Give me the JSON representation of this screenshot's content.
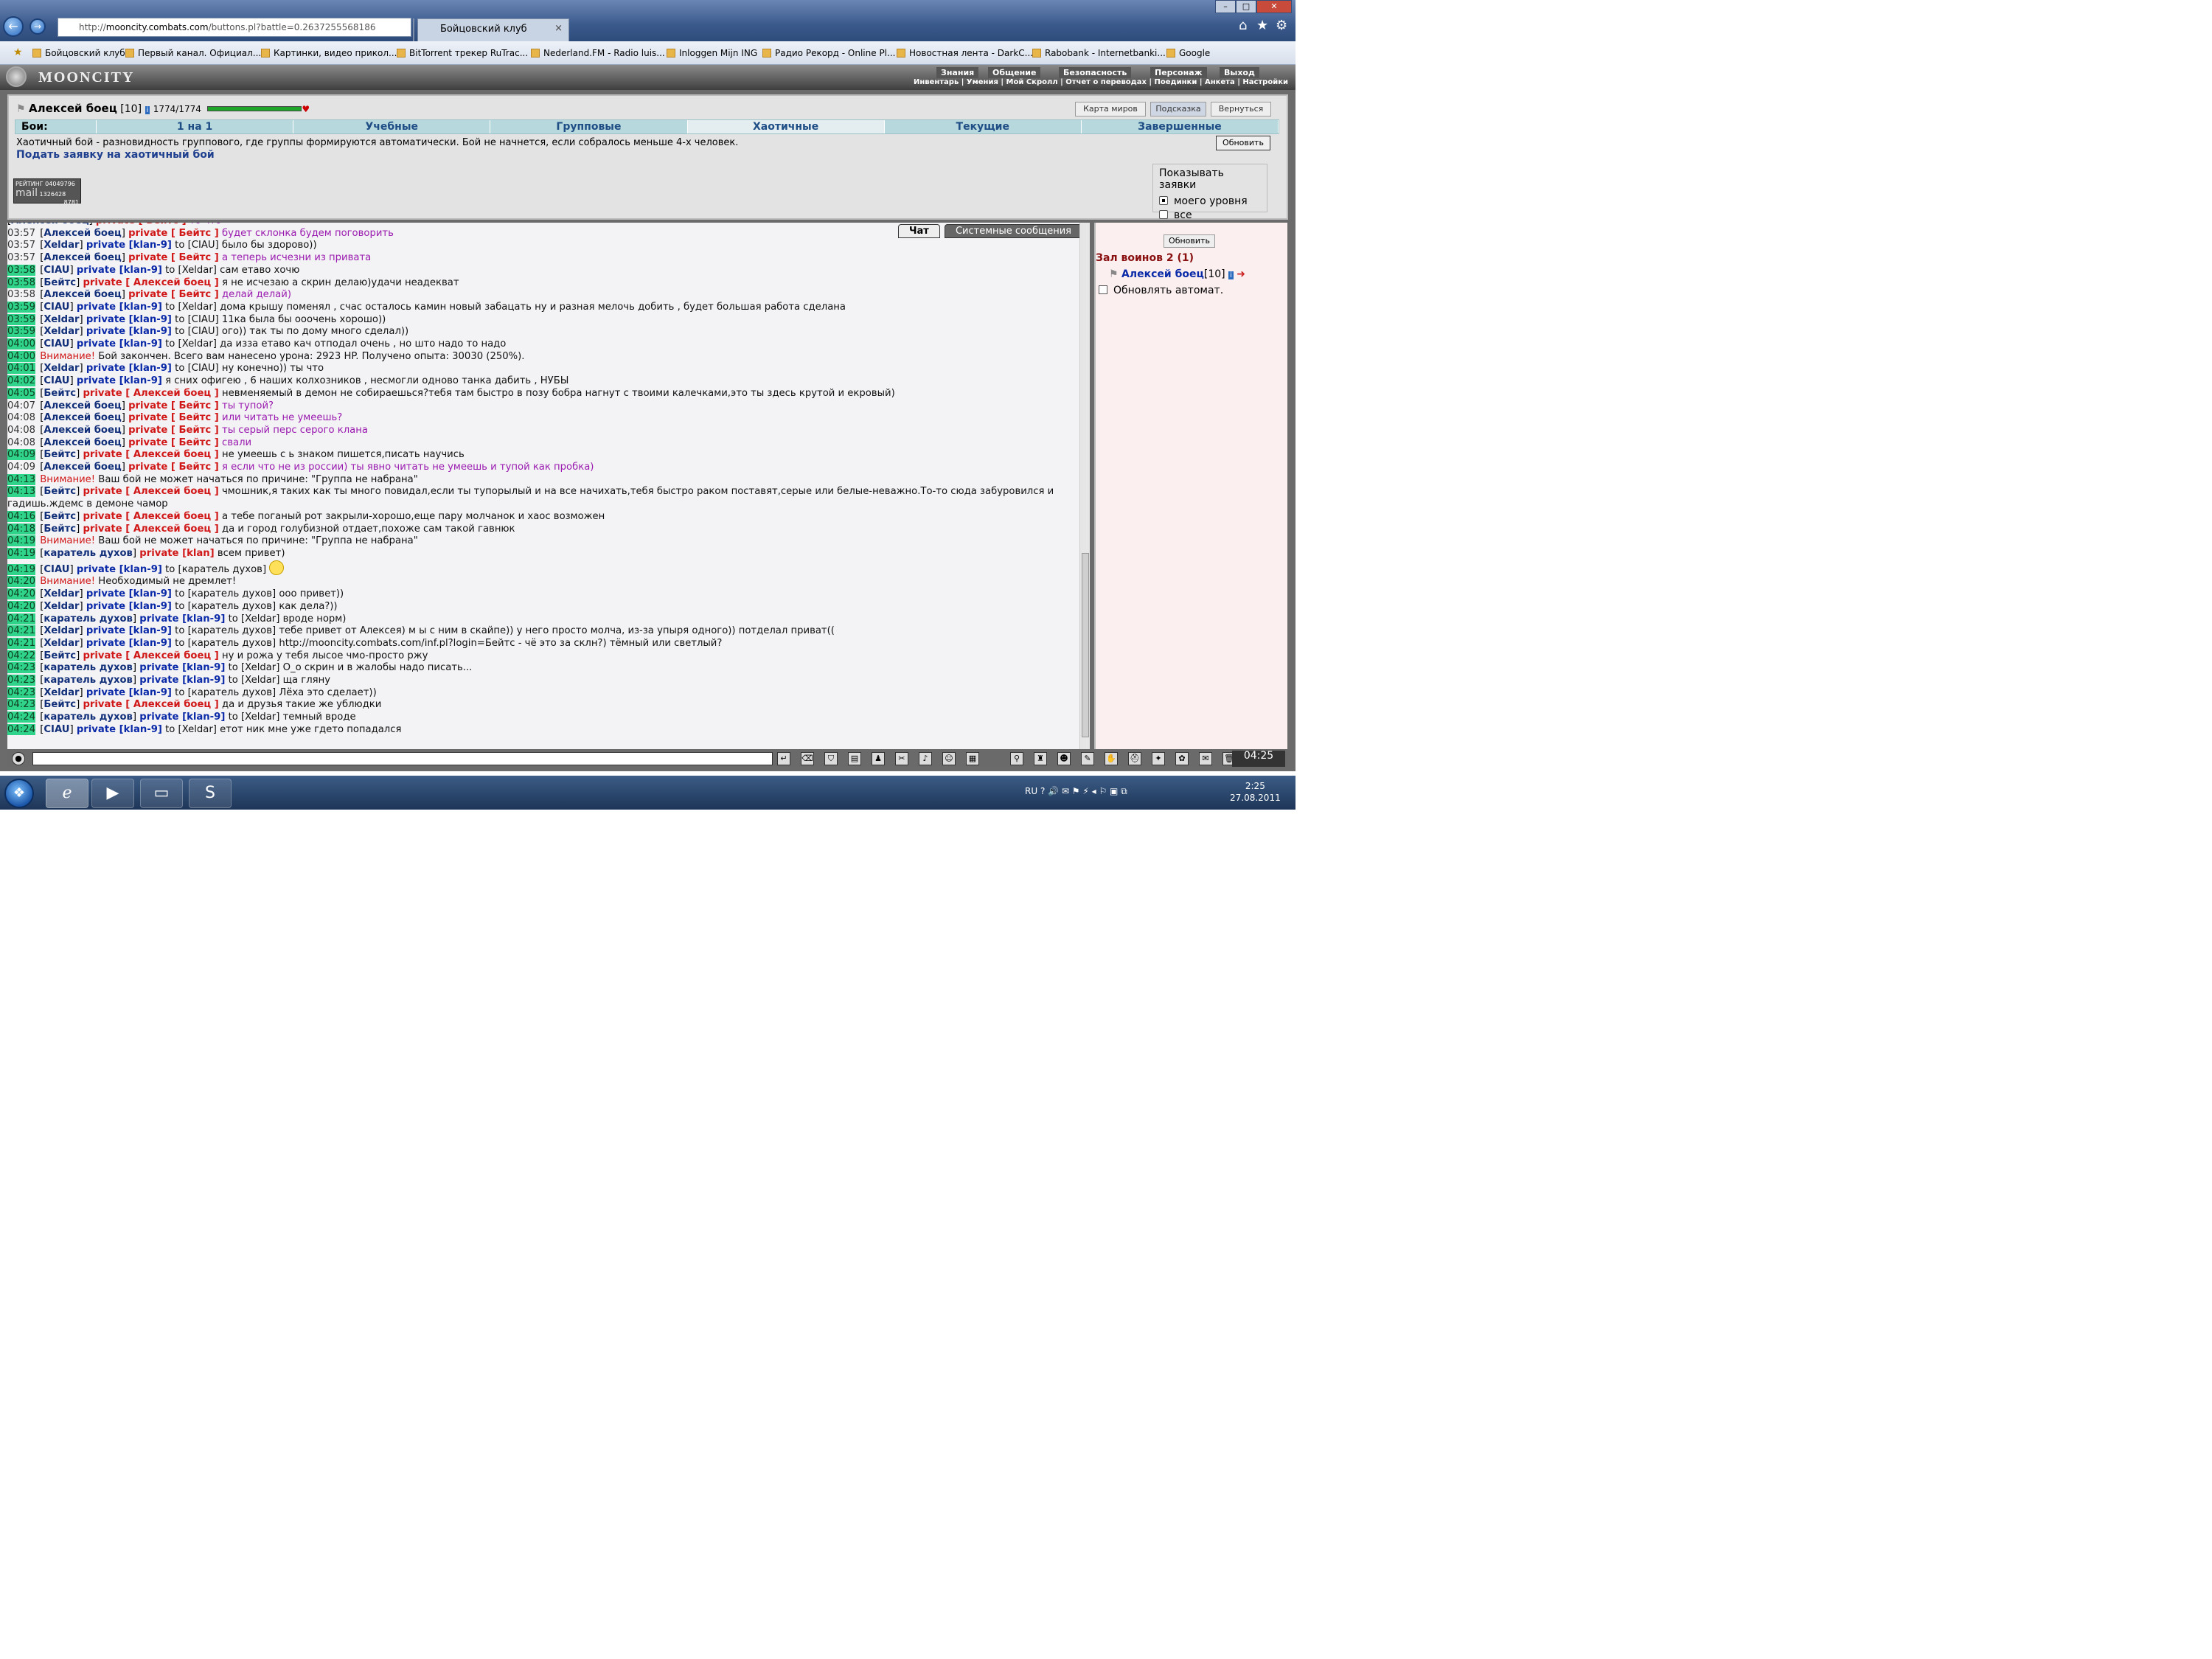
{
  "browser": {
    "url_prefix": "http://",
    "url_domain": "mooncity.combats.com",
    "url_path": "/buttons.pl?battle=0.2637255568186",
    "tab1_label": "",
    "tab2_label": "Бойцовский клуб",
    "favorites": [
      "Бойцовский клуб",
      "Первый канал. Официал...",
      "Картинки, видео прикол...",
      "BitTorrent трекер RuTrac...",
      "Nederland.FM - Radio luis...",
      "Inloggen Mijn ING",
      "Радио Рекорд - Online Pl...",
      "Новостная лента - DarkC...",
      "Rabobank - Internetbanki...",
      "Google"
    ]
  },
  "game": {
    "logo": "MOONCITY",
    "menu": [
      "Знания",
      "Общение",
      "Безопасность",
      "Персонаж",
      "Выход"
    ],
    "submenu": "Инвентарь | Умения | Мой Скролл | Отчет о переводах | Поединки | Анкета | Настройки",
    "player_name": "Алексей боец",
    "player_level": "[10]",
    "player_hp": "1774/1774",
    "btn_map": "Карта миров",
    "btn_hint": "Подсказка",
    "btn_back": "Вернуться",
    "tabs_label": "Бои:",
    "tabs": [
      "1 на 1",
      "Учебные",
      "Групповые",
      "Хаотичные",
      "Текущие",
      "Завершенные"
    ],
    "desc": "Хаотичный бой - разновидность группового, где группы формируются автоматически. Бой не начнется, если собралось меньше 4-х человек.",
    "apply_link": "Подать заявку на хаотичный бой",
    "refresh_btn": "Обновить",
    "counter_top": "РЕЙТИНГ 04049796",
    "counter_mid": "mail",
    "counter_nums": "1326428",
    "counter_bot": "8781",
    "show_title": "Показывать заявки",
    "show_opt1": "моего уровня",
    "show_opt2": "все"
  },
  "chat": {
    "tab_chat": "Чат",
    "tab_sys": "Системные сообщения",
    "lines": [
      {
        "ts": "",
        "name": "Алексей боец",
        "pr": "private [ Бейтс ]",
        "red": true,
        "to": "",
        "msg": "то что",
        "cls": "purple"
      },
      {
        "ts": "03:57",
        "name": "Алексей боец",
        "pr": "private [ Бейтс ]",
        "red": true,
        "to": "",
        "msg": "будет склонка будем поговорить",
        "cls": "purple"
      },
      {
        "ts": "03:57",
        "name": "Xeldar",
        "pr": "private [klan-9]",
        "red": false,
        "to": "to [CIAU]",
        "msg": "было бы здорово))",
        "cls": ""
      },
      {
        "ts": "03:57",
        "name": "Алексей боец",
        "pr": "private [ Бейтс ]",
        "red": true,
        "to": "",
        "msg": "а теперь исчезни из привата",
        "cls": "purple"
      },
      {
        "ts": "03:58",
        "name": "CIAU",
        "pr": "private [klan-9]",
        "red": false,
        "to": "to [Xeldar]",
        "msg": "сам етаво хочю",
        "cls": "",
        "g": true
      },
      {
        "ts": "03:58",
        "name": "Бейтс",
        "pr": "private [ Алексей боец ]",
        "red": true,
        "to": "",
        "msg": "я не исчезаю а скрин делаю)удачи неадекват",
        "cls": "",
        "g": true
      },
      {
        "ts": "03:58",
        "name": "Алексей боец",
        "pr": "private [ Бейтс ]",
        "red": true,
        "to": "",
        "msg": "делай делай)",
        "cls": "purple"
      },
      {
        "ts": "03:59",
        "name": "CIAU",
        "pr": "private [klan-9]",
        "red": false,
        "to": "to [Xeldar]",
        "msg": "дома крышу поменял , счас осталось камин новый забацать ну и разная мелочь добить , будет большая работа сделана",
        "cls": "",
        "g": true
      },
      {
        "ts": "03:59",
        "name": "Xeldar",
        "pr": "private [klan-9]",
        "red": false,
        "to": "to [CIAU]",
        "msg": "11ка была бы ооочень хорошо))",
        "cls": "",
        "g": true
      },
      {
        "ts": "03:59",
        "name": "Xeldar",
        "pr": "private [klan-9]",
        "red": false,
        "to": "to [CIAU]",
        "msg": "ого)) так ты по дому много сделал))",
        "cls": "",
        "g": true
      },
      {
        "ts": "04:00",
        "name": "CIAU",
        "pr": "private [klan-9]",
        "red": false,
        "to": "to [Xeldar]",
        "msg": "да изза етаво кач отподал очень , но што надо то надо",
        "cls": "",
        "g": true
      },
      {
        "ts": "04:00",
        "warn": "Внимание!",
        "msg": "Бой закончен. Всего вам нанесено урона: 2923 HP. Получено опыта: 30030 (250%).",
        "g": true
      },
      {
        "ts": "04:01",
        "name": "Xeldar",
        "pr": "private [klan-9]",
        "red": false,
        "to": "to [CIAU]",
        "msg": "ну конечно)) ты что",
        "cls": "",
        "g": true
      },
      {
        "ts": "04:02",
        "name": "CIAU",
        "pr": "private [klan-9]",
        "red": false,
        "to": "",
        "msg": "я сних офигею , 6 наших колхозников , несмогли одново танка дабить , НУБЫ",
        "cls": "",
        "g": true
      },
      {
        "ts": "04:05",
        "name": "Бейтс",
        "pr": "private [ Алексей боец ]",
        "red": true,
        "to": "",
        "msg": "невменяемый в демон не собираешься?тебя там быстро в позу бобра нагнут с твоими калечками,это ты здесь крутой и екровый)",
        "cls": "",
        "g": true
      },
      {
        "ts": "04:07",
        "name": "Алексей боец",
        "pr": "private [ Бейтс ]",
        "red": true,
        "to": "",
        "msg": "ты тупой?",
        "cls": "purple"
      },
      {
        "ts": "04:08",
        "name": "Алексей боец",
        "pr": "private [ Бейтс ]",
        "red": true,
        "to": "",
        "msg": "или читать не умеешь?",
        "cls": "purple"
      },
      {
        "ts": "04:08",
        "name": "Алексей боец",
        "pr": "private [ Бейтс ]",
        "red": true,
        "to": "",
        "msg": "ты серый перс серого клана",
        "cls": "purple"
      },
      {
        "ts": "04:08",
        "name": "Алексей боец",
        "pr": "private [ Бейтс ]",
        "red": true,
        "to": "",
        "msg": "свали",
        "cls": "purple"
      },
      {
        "ts": "04:09",
        "name": "Бейтс",
        "pr": "private [ Алексей боец ]",
        "red": true,
        "to": "",
        "msg": "не умеешь с ь знаком пишется,писать научись",
        "cls": "",
        "g": true
      },
      {
        "ts": "04:09",
        "name": "Алексей боец",
        "pr": "private [ Бейтс ]",
        "red": true,
        "to": "",
        "msg": "я если что не из россии) ты явно читать не умеешь и тупой как пробка)",
        "cls": "purple"
      },
      {
        "ts": "04:13",
        "warn": "Внимание!",
        "msg": "Ваш бой не может начаться по причине: \"Группа не набрана\"",
        "g": true
      },
      {
        "ts": "04:13",
        "name": "Бейтс",
        "pr": "private [ Алексей боец ]",
        "red": true,
        "to": "",
        "msg": "чмошник,я таких как ты много повидал,если ты тупорылый и на все начихать,тебя быстро раком поставят,серые или белые-неважно.То-то сюда забуровился и гадишь.ждемс в демоне чамор",
        "cls": "",
        "g": true,
        "wrap": true
      },
      {
        "ts": "04:16",
        "name": "Бейтс",
        "pr": "private [ Алексей боец ]",
        "red": true,
        "to": "",
        "msg": "а тебе поганый рот закрыли-хорошо,еще пару молчанок и хаос возможен",
        "cls": "",
        "g": true
      },
      {
        "ts": "04:18",
        "name": "Бейтс",
        "pr": "private [ Алексей боец ]",
        "red": true,
        "to": "",
        "msg": "да и город голубизной отдает,похоже сам такой гавнюк",
        "cls": "",
        "g": true
      },
      {
        "ts": "04:19",
        "warn": "Внимание!",
        "msg": "Ваш бой не может начаться по причине: \"Группа не набрана\"",
        "g": true
      },
      {
        "ts": "04:19",
        "name": "каратель духов",
        "pr": "private [klan]",
        "red": true,
        "to": "",
        "msg": "всем привет)",
        "cls": "",
        "g": true
      },
      {
        "ts": "04:19",
        "name": "CIAU",
        "pr": "private [klan-9]",
        "red": false,
        "to": "to [каратель духов]",
        "msg": "",
        "cls": "",
        "g": true,
        "smile": true
      },
      {
        "ts": "04:20",
        "warn": "Внимание!",
        "msg": "Необходимый не дремлет!",
        "g": true
      },
      {
        "ts": "04:20",
        "name": "Xeldar",
        "pr": "private [klan-9]",
        "red": false,
        "to": "to [каратель духов]",
        "msg": "ооо привет))",
        "cls": "",
        "g": true
      },
      {
        "ts": "04:20",
        "name": "Xeldar",
        "pr": "private [klan-9]",
        "red": false,
        "to": "to [каратель духов]",
        "msg": "как дела?))",
        "cls": "",
        "g": true
      },
      {
        "ts": "04:21",
        "name": "каратель духов",
        "pr": "private [klan-9]",
        "red": false,
        "to": "to [Xeldar]",
        "msg": "вроде норм)",
        "cls": "",
        "g": true
      },
      {
        "ts": "04:21",
        "name": "Xeldar",
        "pr": "private [klan-9]",
        "red": false,
        "to": "to [каратель духов]",
        "msg": "тебе привет от Алексея) м ы с ним в скайпе)) у него просто молча, из-за упыря одного)) потделал приват((",
        "cls": "",
        "g": true
      },
      {
        "ts": "04:21",
        "name": "Xeldar",
        "pr": "private [klan-9]",
        "red": false,
        "to": "to [каратель духов]",
        "msg": "http://mooncity.combats.com/inf.pl?login=Бейтс - чё это за склн?) тёмный или светлый?",
        "cls": "",
        "g": true
      },
      {
        "ts": "04:22",
        "name": "Бейтс",
        "pr": "private [ Алексей боец ]",
        "red": true,
        "to": "",
        "msg": "ну и рожа у тебя лысое чмо-просто ржу",
        "cls": "",
        "g": true
      },
      {
        "ts": "04:23",
        "name": "каратель духов",
        "pr": "private [klan-9]",
        "red": false,
        "to": "to [Xeldar]",
        "msg": "О_о скрин и в жалобы надо писать...",
        "cls": "",
        "g": true
      },
      {
        "ts": "04:23",
        "name": "каратель духов",
        "pr": "private [klan-9]",
        "red": false,
        "to": "to [Xeldar]",
        "msg": "ща гляну",
        "cls": "",
        "g": true
      },
      {
        "ts": "04:23",
        "name": "Xeldar",
        "pr": "private [klan-9]",
        "red": false,
        "to": "to [каратель духов]",
        "msg": "Лёха это сделает))",
        "cls": "",
        "g": true
      },
      {
        "ts": "04:23",
        "name": "Бейтс",
        "pr": "private [ Алексей боец ]",
        "red": true,
        "to": "",
        "msg": "да и друзья такие же ублюдки",
        "cls": "",
        "g": true
      },
      {
        "ts": "04:24",
        "name": "каратель духов",
        "pr": "private [klan-9]",
        "red": false,
        "to": "to [Xeldar]",
        "msg": "темный вроде",
        "cls": "",
        "g": true
      },
      {
        "ts": "04:24",
        "name": "CIAU",
        "pr": "private [klan-9]",
        "red": false,
        "to": "to [Xeldar]",
        "msg": "етот ник мне уже гдето попадался",
        "cls": "",
        "g": true
      }
    ]
  },
  "side": {
    "refresh": "Обновить",
    "hall": "Зал воинов 2 (1)",
    "player": "Алексей боец",
    "player_level": "[10]",
    "auto": "Обновлять автомат."
  },
  "bottom": {
    "clock": "04:25"
  },
  "taskbar": {
    "lang": "RU",
    "time": "2:25",
    "date": "27.08.2011"
  }
}
